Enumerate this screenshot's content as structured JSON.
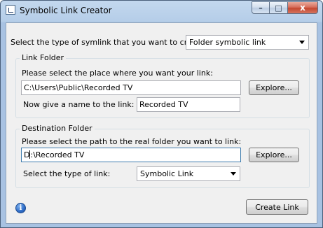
{
  "window": {
    "title": "Symbolic Link Creator",
    "caption_buttons": {
      "minimize": "–",
      "maximize": "□",
      "close": "x"
    }
  },
  "symlink_type": {
    "prompt": "Select the type of symlink that you want to create:",
    "selected": "Folder symbolic link"
  },
  "link_folder": {
    "group_title": "Link Folder",
    "place_prompt": "Please select the place where you want your link:",
    "path_value": "C:\\Users\\Public\\Recorded TV",
    "explore_label": "Explore...",
    "name_prompt": "Now give a name to the link:",
    "name_value": "Recorded TV"
  },
  "destination_folder": {
    "group_title": "Destination Folder",
    "path_prompt": "Please select the path to the real folder you want to link:",
    "path_before_caret": "D",
    "path_after_caret": ":\\Recorded TV",
    "explore_label": "Explore...",
    "link_type_prompt": "Select the type of link:",
    "link_type_selected": "Symbolic Link"
  },
  "footer": {
    "info_glyph": "i",
    "create_label": "Create Link"
  }
}
